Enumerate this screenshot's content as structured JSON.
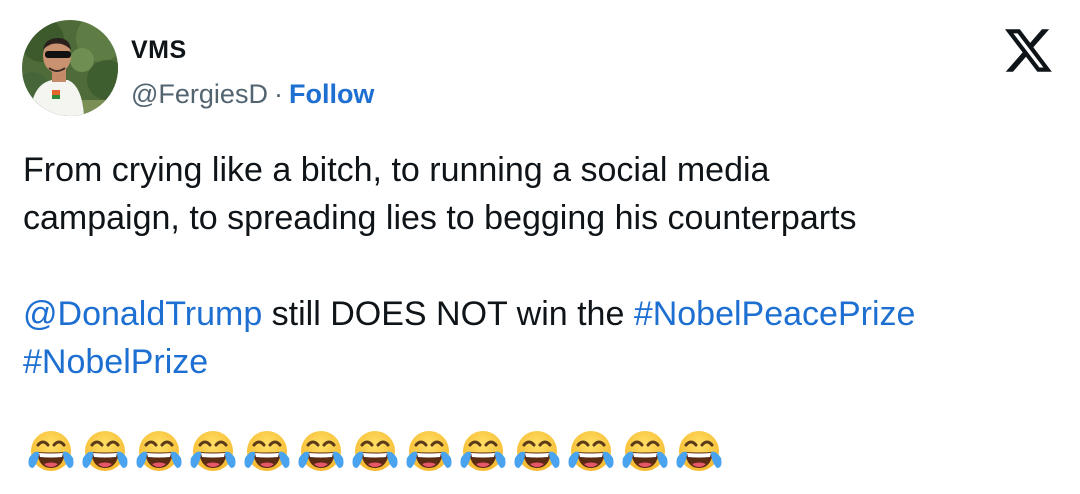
{
  "author": {
    "display_name": "VMS",
    "handle": "@FergiesD",
    "separator": "·",
    "follow_label": "Follow"
  },
  "tweet": {
    "line1": "From crying like a bitch, to running a social media",
    "line2": "campaign, to spreading lies to begging his counterparts",
    "mention": "@DonaldTrump",
    "mid_text": " still DOES NOT win the ",
    "hashtag1": "#NobelPeacePrize",
    "hashtag2": "#NobelPrize",
    "emoji_count": 13,
    "emoji_name": "face-with-tears-of-joy"
  },
  "icons": {
    "platform_logo": "x-logo-icon",
    "avatar": "avatar"
  },
  "colors": {
    "link": "#1d6fd1",
    "text": "#0f1419",
    "secondary_text": "#536471",
    "background": "#ffffff"
  }
}
